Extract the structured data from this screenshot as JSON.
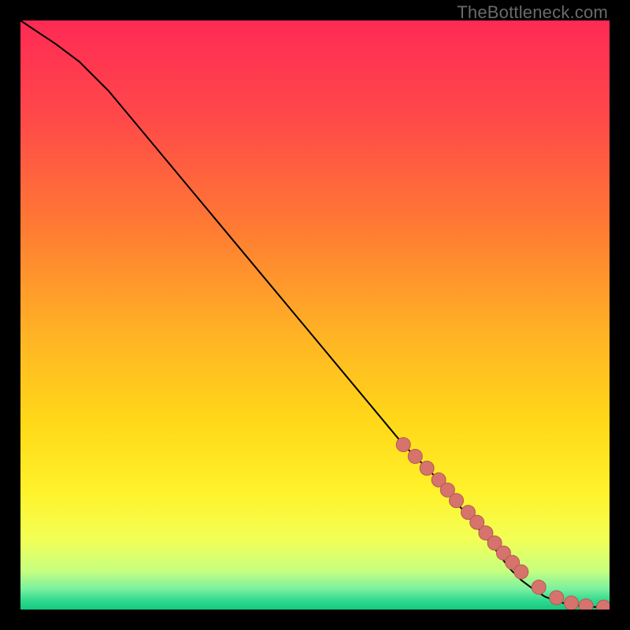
{
  "attribution": "TheBottleneck.com",
  "colors": {
    "gradient_stops": [
      {
        "offset": 0.0,
        "color": "#ff2a55"
      },
      {
        "offset": 0.17,
        "color": "#ff4a49"
      },
      {
        "offset": 0.35,
        "color": "#ff7a33"
      },
      {
        "offset": 0.53,
        "color": "#ffb225"
      },
      {
        "offset": 0.68,
        "color": "#ffd818"
      },
      {
        "offset": 0.8,
        "color": "#fff22a"
      },
      {
        "offset": 0.88,
        "color": "#f3ff55"
      },
      {
        "offset": 0.935,
        "color": "#c6ff80"
      },
      {
        "offset": 0.965,
        "color": "#7af0a0"
      },
      {
        "offset": 0.985,
        "color": "#2fd98e"
      },
      {
        "offset": 1.0,
        "color": "#15c97f"
      }
    ],
    "curve": "#000000",
    "dot_fill": "#d6736c",
    "dot_stroke": "#b45a53"
  },
  "chart_data": {
    "type": "line",
    "title": "",
    "xlabel": "",
    "ylabel": "",
    "xlim": [
      0,
      100
    ],
    "ylim": [
      0,
      100
    ],
    "series": [
      {
        "name": "curve",
        "x": [
          0,
          3,
          6,
          10,
          15,
          20,
          25,
          30,
          35,
          40,
          45,
          50,
          55,
          60,
          65,
          70,
          75,
          80,
          83,
          85,
          87,
          89,
          91,
          93,
          95,
          97,
          100
        ],
        "y": [
          100,
          98,
          96,
          93,
          88,
          82,
          76,
          70,
          64,
          58,
          52,
          46,
          40,
          34,
          28,
          23,
          17,
          11,
          7,
          5,
          3.5,
          2.2,
          1.4,
          0.9,
          0.6,
          0.45,
          0.4
        ]
      }
    ],
    "dots": {
      "name": "highlighted-segment",
      "x": [
        65,
        67,
        69,
        71,
        72.5,
        74,
        76,
        77.5,
        79,
        80.5,
        82,
        83.5,
        85,
        88,
        91,
        93.5,
        96,
        99
      ],
      "y": [
        28,
        26,
        24,
        22,
        20.3,
        18.5,
        16.5,
        14.8,
        13,
        11.3,
        9.6,
        8.0,
        6.4,
        3.8,
        2.0,
        1.1,
        0.6,
        0.4
      ]
    }
  }
}
